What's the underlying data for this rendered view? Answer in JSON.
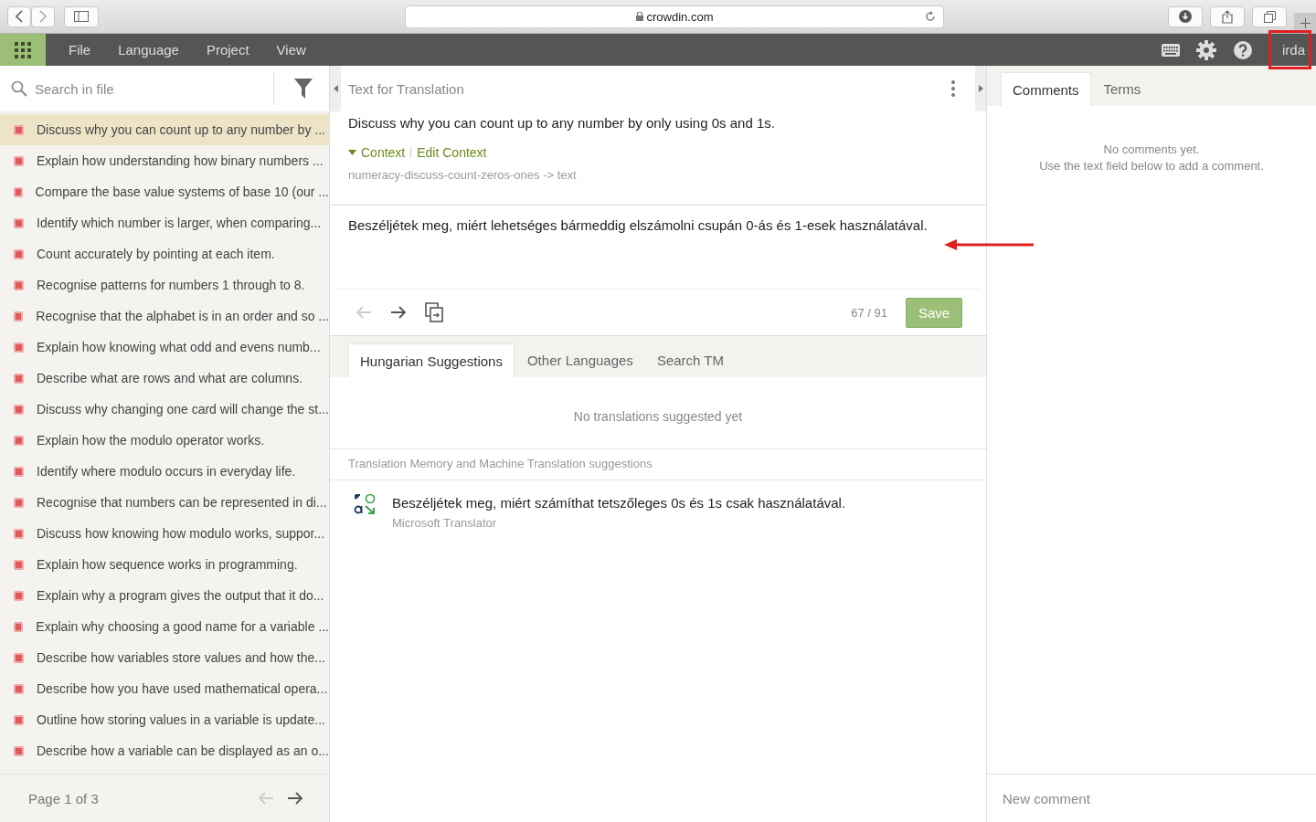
{
  "browser": {
    "address": "crowdin.com"
  },
  "menu": [
    "File",
    "Language",
    "Project",
    "View"
  ],
  "user": "irda",
  "sidebar": {
    "search": {
      "placeholder": "Search in file"
    },
    "items": [
      {
        "text": "Discuss why you can count up to any number by ...",
        "selected": true
      },
      {
        "text": "Explain how understanding how binary numbers ...",
        "selected": false
      },
      {
        "text": "Compare the base value systems of base 10 (our ...",
        "selected": false
      },
      {
        "text": "Identify which number is larger, when comparing...",
        "selected": false
      },
      {
        "text": "Count accurately by pointing at each item.",
        "selected": false
      },
      {
        "text": "Recognise patterns for numbers 1 through to 8.",
        "selected": false
      },
      {
        "text": "Recognise that the alphabet is in an order and so ...",
        "selected": false
      },
      {
        "text": "Explain how knowing what odd and evens numb...",
        "selected": false
      },
      {
        "text": "Describe what are rows and what are columns.",
        "selected": false
      },
      {
        "text": "Discuss why changing one card will change the st...",
        "selected": false
      },
      {
        "text": "Explain how the modulo operator works.",
        "selected": false
      },
      {
        "text": "Identify where modulo occurs in everyday life.",
        "selected": false
      },
      {
        "text": "Recognise that numbers can be represented in di...",
        "selected": false
      },
      {
        "text": "Discuss how knowing how modulo works, suppor...",
        "selected": false
      },
      {
        "text": "Explain how sequence works in programming.",
        "selected": false
      },
      {
        "text": "Explain why a program gives the output that it do...",
        "selected": false
      },
      {
        "text": "Explain why choosing a good name for a variable ...",
        "selected": false
      },
      {
        "text": "Describe how variables store values and how the...",
        "selected": false
      },
      {
        "text": "Describe how you have used mathematical opera...",
        "selected": false
      },
      {
        "text": "Outline how storing values in a variable is update...",
        "selected": false
      },
      {
        "text": "Describe how a variable can be displayed as an o...",
        "selected": false
      }
    ],
    "pager": "Page 1 of 3"
  },
  "editor": {
    "title": "Text for Translation",
    "source": "Discuss why you can count up to any number by only using 0s and 1s.",
    "context_toggle": "Context",
    "edit_context": "Edit Context",
    "key": "numeracy-discuss-count-zeros-ones -> text",
    "translation": "Beszéljétek meg, miért lehetséges bármeddig elszámolni csupán 0-ás és 1-esek használatával.",
    "counter": "67 / 91",
    "save": "Save"
  },
  "suggestion_tabs": [
    {
      "label": "Hungarian Suggestions",
      "selected": true
    },
    {
      "label": "Other Languages",
      "selected": false
    },
    {
      "label": "Search TM",
      "selected": false
    }
  ],
  "no_suggestions": "No translations suggested yet",
  "tm_header": "Translation Memory and Machine Translation suggestions",
  "tm_suggestions": [
    {
      "text": "Beszéljétek meg, miért számíthat tetszőleges 0s és 1s csak használatával.",
      "source": "Microsoft Translator"
    }
  ],
  "right_tabs": [
    {
      "label": "Comments",
      "selected": true
    },
    {
      "label": "Terms",
      "selected": false
    }
  ],
  "comments_empty": [
    "No comments yet.",
    "Use the text field below to add a comment."
  ],
  "new_comment": {
    "placeholder": "New comment"
  }
}
